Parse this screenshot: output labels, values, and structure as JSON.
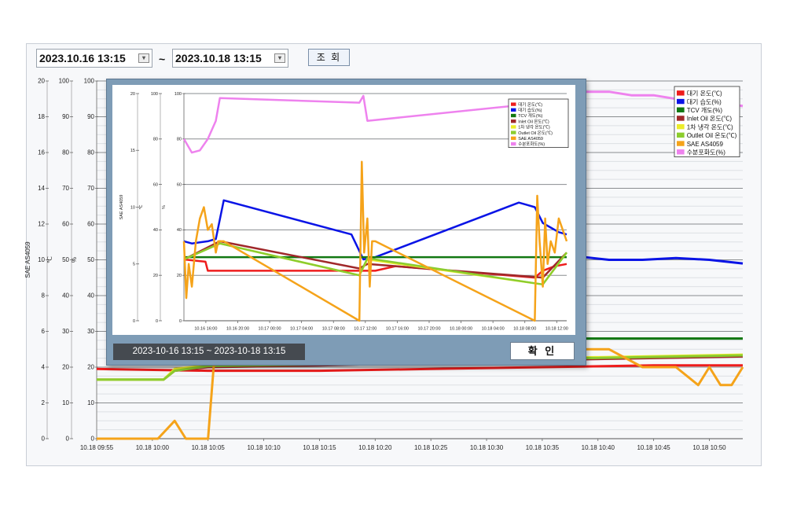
{
  "filter": {
    "start_date": "2023.10.16 13:15",
    "end_date": "2023.10.18 13:15",
    "tilde": "~",
    "query_button": "조 회"
  },
  "popup": {
    "range_text": "2023-10-16 13:15 ~ 2023-10-18 13:15",
    "confirm_button": "확 인"
  },
  "colors": {
    "temp": "#ee1c1c",
    "humidity": "#0a14e6",
    "tcv": "#117711",
    "inlet_oil": "#a0282a",
    "cool1": "#ecec2a",
    "outlet_oil": "#8ccd2e",
    "sae": "#f5a31a",
    "moisture": "#ee82ee"
  },
  "chart_data": [
    {
      "type": "line",
      "title": "",
      "axes": [
        {
          "label": "SAE AS4059",
          "ticks": [
            "0",
            "2",
            "4",
            "6",
            "8",
            "10",
            "12",
            "14",
            "16",
            "18",
            "20"
          ],
          "range": [
            0,
            20
          ]
        },
        {
          "label": "℃",
          "ticks": [
            "0",
            "10",
            "20",
            "30",
            "40",
            "50",
            "60",
            "70",
            "80",
            "90",
            "100"
          ],
          "range": [
            0,
            100
          ]
        },
        {
          "label": "%",
          "ticks": [
            "0",
            "10",
            "20",
            "30",
            "40",
            "50",
            "60",
            "70",
            "80",
            "90",
            "100"
          ],
          "range": [
            0,
            100
          ]
        }
      ],
      "x": [
        "10.18 09:55",
        "10.18 10:00",
        "10.18 10:05",
        "10.18 10:10",
        "10.18 10:15",
        "10.18 10:20",
        "10.18 10:25",
        "10.18 10:30",
        "10.18 10:35",
        "10.18 10:40",
        "10.18 10:45",
        "10.18 10:50"
      ],
      "xlim": [
        "09:55",
        "10:53"
      ],
      "grid": true,
      "legend_position": "top-right",
      "series": [
        {
          "name": "대기 온도(℃)",
          "key": "temp",
          "points": [
            [
              0,
              19.5
            ],
            [
              10,
              19
            ],
            [
              20,
              19
            ],
            [
              30,
              19.5
            ],
            [
              40,
              20
            ],
            [
              50,
              20.5
            ],
            [
              58,
              20.5
            ]
          ]
        },
        {
          "name": "대기 습도(%)",
          "key": "humidity",
          "points": [
            [
              40,
              51
            ],
            [
              43,
              51
            ],
            [
              46,
              50
            ],
            [
              49,
              50
            ],
            [
              52,
              50.5
            ],
            [
              55,
              50
            ],
            [
              58,
              49
            ]
          ]
        },
        {
          "name": "TCV 개도(%)",
          "key": "tcv",
          "points": [
            [
              40,
              28
            ],
            [
              58,
              28
            ]
          ]
        },
        {
          "name": "Inlet Oil 온도(℃)",
          "key": "inlet_oil",
          "points": [
            [
              0,
              16.5
            ],
            [
              6,
              16.5
            ],
            [
              7,
              19
            ],
            [
              10,
              20
            ],
            [
              20,
              20.5
            ],
            [
              40,
              22
            ],
            [
              58,
              23
            ]
          ]
        },
        {
          "name": "1차 냉각 온도(℃)",
          "key": "cool1",
          "points": [
            [
              0,
              16.5
            ],
            [
              6,
              16.5
            ],
            [
              7,
              19.5
            ],
            [
              10,
              20.5
            ],
            [
              20,
              21
            ],
            [
              40,
              22.5
            ],
            [
              58,
              23.5
            ]
          ]
        },
        {
          "name": "Outlet Oil 온도(℃)",
          "key": "outlet_oil",
          "points": [
            [
              0,
              16.5
            ],
            [
              6,
              16.5
            ],
            [
              7,
              19
            ],
            [
              10,
              20.3
            ],
            [
              20,
              20.8
            ],
            [
              40,
              22.3
            ],
            [
              58,
              23.3
            ]
          ]
        },
        {
          "name": "SAE AS4059",
          "key": "sae",
          "points": [
            [
              0,
              0
            ],
            [
              5.5,
              0
            ],
            [
              7,
              1
            ],
            [
              8,
              0
            ],
            [
              10,
              0
            ],
            [
              10.5,
              4
            ],
            [
              11,
              6
            ],
            [
              40,
              6
            ],
            [
              42,
              6
            ],
            [
              43,
              5
            ],
            [
              46,
              5
            ],
            [
              49,
              4
            ],
            [
              52,
              4
            ],
            [
              54,
              3
            ],
            [
              55,
              4
            ],
            [
              56,
              3
            ],
            [
              57,
              3
            ],
            [
              58,
              4
            ]
          ]
        },
        {
          "name": "수분포화도(%)",
          "key": "moisture",
          "points": [
            [
              40,
              97
            ],
            [
              46,
              97
            ],
            [
              48,
              96
            ],
            [
              50,
              96
            ],
            [
              52,
              95
            ],
            [
              55,
              94
            ],
            [
              58,
              93
            ]
          ]
        }
      ]
    },
    {
      "type": "line",
      "title": "",
      "axes": [
        {
          "label": "SAE AS4059",
          "ticks": [
            "0",
            "5",
            "10",
            "15",
            "20"
          ],
          "range": [
            0,
            20
          ]
        },
        {
          "label": "℃",
          "ticks": [
            "0",
            "20",
            "40",
            "60",
            "80",
            "100"
          ],
          "range": [
            0,
            100
          ]
        },
        {
          "label": "%",
          "ticks": [
            "0",
            "20",
            "40",
            "60",
            "80",
            "100"
          ],
          "range": [
            0,
            100
          ]
        }
      ],
      "x": [
        "10.16 16:00",
        "10.16 20:00",
        "10.17 00:00",
        "10.17 04:00",
        "10.17 08:00",
        "10.17 12:00",
        "10.17 16:00",
        "10.17 20:00",
        "10.18 00:00",
        "10.18 04:00",
        "10.18 08:00",
        "10.18 12:00"
      ],
      "xlim": [
        "10.16 13:15",
        "10.18 13:15"
      ],
      "grid": true,
      "legend_position": "top-right",
      "series": [
        {
          "name": "대기 온도(℃)",
          "key": "temp",
          "points": [
            [
              0,
              27
            ],
            [
              2.7,
              26
            ],
            [
              3,
              22
            ],
            [
              24,
              22
            ],
            [
              26.5,
              24
            ],
            [
              44,
              19
            ],
            [
              45,
              22
            ],
            [
              46.5,
              24
            ],
            [
              48,
              25
            ]
          ]
        },
        {
          "name": "대기 습도(%)",
          "key": "humidity",
          "points": [
            [
              0,
              35
            ],
            [
              1,
              34
            ],
            [
              2,
              34.5
            ],
            [
              3,
              35
            ],
            [
              4,
              36
            ],
            [
              5,
              53
            ],
            [
              21,
              38
            ],
            [
              22.5,
              27
            ],
            [
              24,
              28
            ],
            [
              42,
              52
            ],
            [
              43,
              51
            ],
            [
              44,
              50
            ],
            [
              45,
              43
            ],
            [
              46,
              41
            ],
            [
              47,
              39
            ],
            [
              48,
              38
            ]
          ]
        },
        {
          "name": "TCV 개도(%)",
          "key": "tcv",
          "points": [
            [
              0,
              28
            ],
            [
              48,
              28
            ]
          ]
        },
        {
          "name": "Inlet Oil 온도(℃)",
          "key": "inlet_oil",
          "points": [
            [
              0,
              27
            ],
            [
              4.5,
              35
            ],
            [
              22,
              23
            ],
            [
              23,
              25
            ],
            [
              45,
              19
            ],
            [
              48,
              30
            ]
          ]
        },
        {
          "name": "1차 냉각 온도(℃)",
          "key": "cool1",
          "points": [
            [
              0,
              27
            ],
            [
              4.5,
              34
            ],
            [
              22,
              20
            ],
            [
              23,
              27
            ],
            [
              45,
              16
            ],
            [
              48,
              30
            ]
          ]
        },
        {
          "name": "Outlet Oil 온도(℃)",
          "key": "outlet_oil",
          "points": [
            [
              0,
              27
            ],
            [
              4.5,
              34
            ],
            [
              22,
              20
            ],
            [
              23,
              27.5
            ],
            [
              45,
              16
            ],
            [
              48,
              30
            ]
          ]
        },
        {
          "name": "SAE AS4059",
          "key": "sae",
          "points": [
            [
              0,
              7
            ],
            [
              0.3,
              2
            ],
            [
              0.6,
              5
            ],
            [
              1,
              3
            ],
            [
              1.5,
              7
            ],
            [
              2,
              9
            ],
            [
              2.5,
              10
            ],
            [
              3,
              8
            ],
            [
              3.5,
              8.5
            ],
            [
              4,
              6
            ],
            [
              4.3,
              7
            ],
            [
              5,
              7
            ],
            [
              22,
              0
            ],
            [
              22.3,
              14
            ],
            [
              22.6,
              6
            ],
            [
              23,
              9
            ],
            [
              23.3,
              3
            ],
            [
              23.6,
              7
            ],
            [
              24,
              7
            ],
            [
              44,
              0
            ],
            [
              44.3,
              11
            ],
            [
              44.6,
              7
            ],
            [
              45,
              3
            ],
            [
              45.3,
              9
            ],
            [
              45.6,
              5
            ],
            [
              46,
              7
            ],
            [
              46.5,
              6
            ],
            [
              47,
              9
            ],
            [
              48,
              7
            ]
          ]
        },
        {
          "name": "수분포화도(%)",
          "key": "moisture",
          "points": [
            [
              0,
              80
            ],
            [
              1,
              74
            ],
            [
              2,
              75
            ],
            [
              3,
              80
            ],
            [
              4,
              88
            ],
            [
              4.5,
              98
            ],
            [
              22,
              96
            ],
            [
              22.5,
              99
            ],
            [
              23,
              88
            ],
            [
              48,
              97
            ]
          ]
        }
      ]
    }
  ]
}
